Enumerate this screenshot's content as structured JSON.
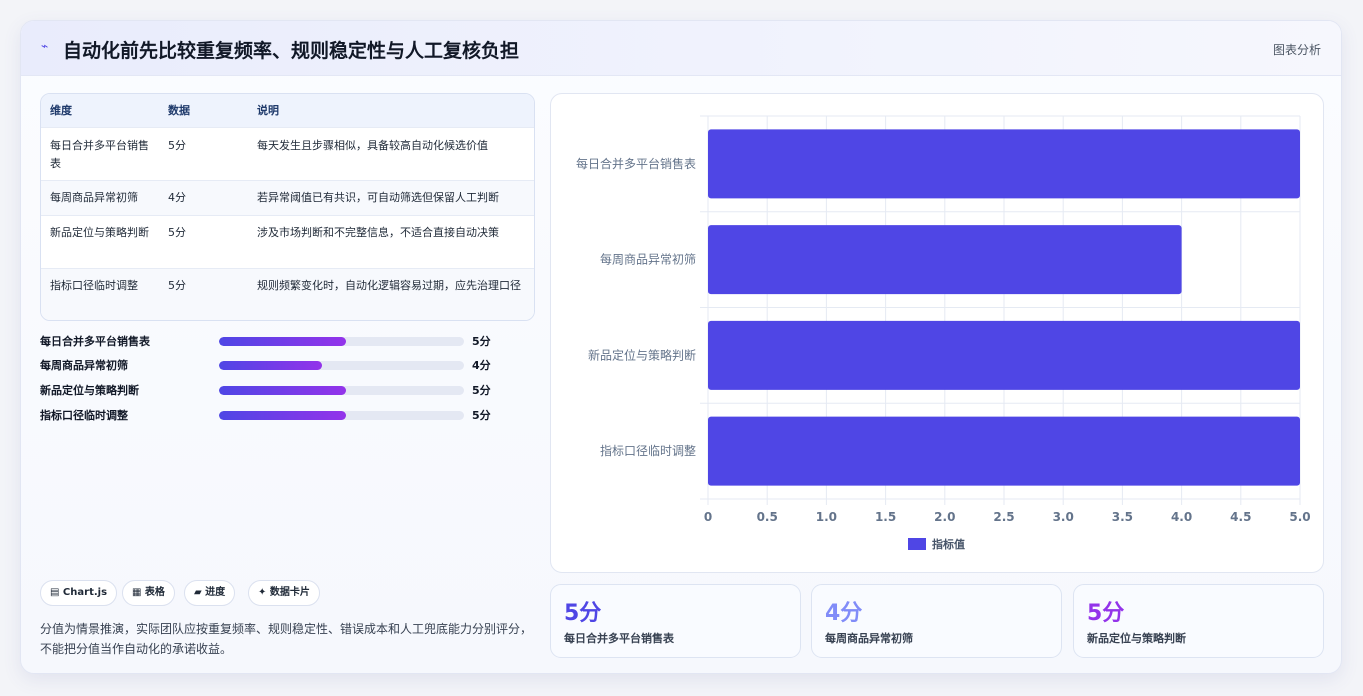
{
  "header": {
    "logo": "⌁",
    "title": "自动化前先比较重复频率、规则稳定性与人工复核负担",
    "tag": "图表分析"
  },
  "table": {
    "columns": [
      "维度",
      "数据",
      "说明"
    ],
    "rows": [
      [
        "每日合并多平台销售表",
        "5分",
        "每天发生且步骤相似，具备较高自动化候选价值"
      ],
      [
        "每周商品异常初筛",
        "4分",
        "若异常阈值已有共识，可自动筛选但保留人工判断"
      ],
      [
        "新品定位与策略判断",
        "5分",
        "涉及市场判断和不完整信息，不适合直接自动决策"
      ],
      [
        "指标口径临时调整",
        "5分",
        "规则频繁变化时，自动化逻辑容易过期，应先治理口径"
      ]
    ]
  },
  "progress": [
    {
      "label": "每日合并多平台销售表",
      "value_text": "5分",
      "fraction": 0.52
    },
    {
      "label": "每周商品异常初筛",
      "value_text": "4分",
      "fraction": 0.42
    },
    {
      "label": "新品定位与策略判断",
      "value_text": "5分",
      "fraction": 0.52
    },
    {
      "label": "指标口径临时调整",
      "value_text": "5分",
      "fraction": 0.52
    }
  ],
  "chips": [
    "▤ Chart.js",
    "▦ 表格",
    "▰ 进度",
    "✦ 数据卡片"
  ],
  "note": "分值为情景推演，实际团队应按重复频率、规则稳定性、错误成本和人工兜底能力分别评分，不能把分值当作自动化的承诺收益。",
  "stats": [
    {
      "num": "5分",
      "cap": "每日合并多平台销售表",
      "color": "#4f46e5"
    },
    {
      "num": "4分",
      "cap": "每周商品异常初筛",
      "color": "#818cf8"
    },
    {
      "num": "5分",
      "cap": "新品定位与策略判断",
      "color": "#9333ea"
    }
  ],
  "chart_data": {
    "type": "bar",
    "orientation": "horizontal",
    "categories": [
      "每日合并多平台销售表",
      "每周商品异常初筛",
      "新品定位与策略判断",
      "指标口径临时调整"
    ],
    "series": [
      {
        "name": "指标值",
        "values": [
          5,
          4,
          5,
          5
        ],
        "color": "#4f46e5"
      }
    ],
    "xlim": [
      0,
      5
    ],
    "xticks": [
      "0",
      "0.5",
      "1.0",
      "1.5",
      "2.0",
      "2.5",
      "3.0",
      "3.5",
      "4.0",
      "4.5",
      "5.0"
    ],
    "grid": true,
    "legend": "bottom"
  }
}
